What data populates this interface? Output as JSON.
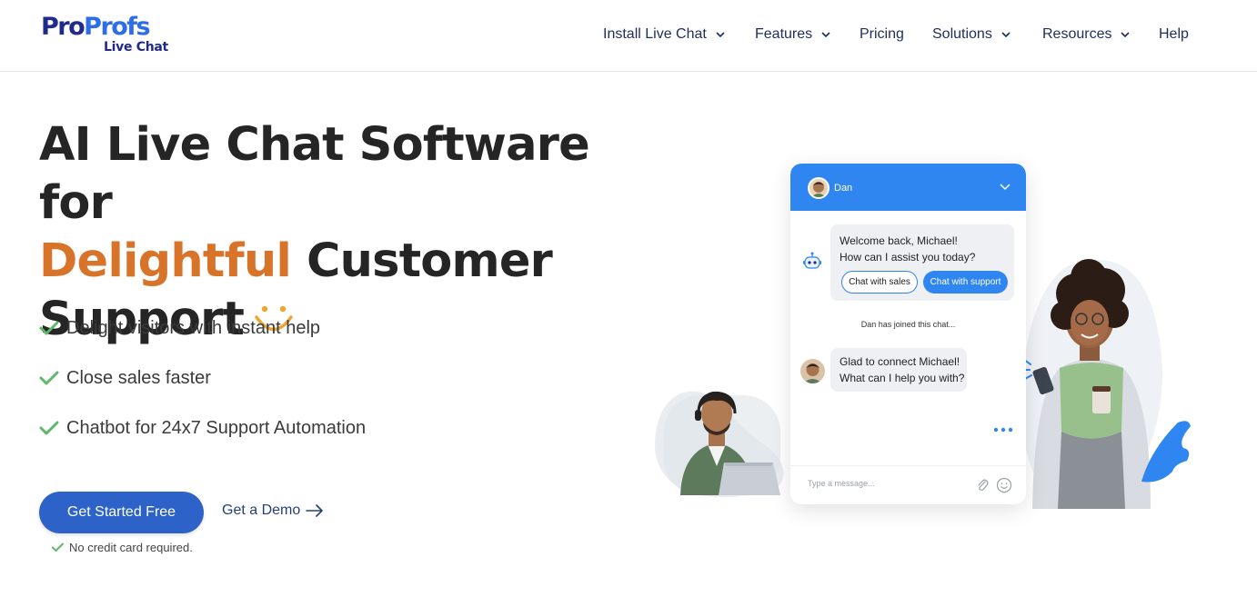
{
  "brand": {
    "logo_part1": "Pro",
    "logo_part2": "Profs",
    "logo_sub": "Live Chat",
    "colors": {
      "navy": "#1f2a8a",
      "blue": "#2d6ee8",
      "accent": "#d8742a",
      "cta": "#2d63c8",
      "check": "#5fb86a"
    }
  },
  "nav": {
    "items": [
      {
        "label": "Install Live Chat",
        "has_dropdown": true
      },
      {
        "label": "Features",
        "has_dropdown": true
      },
      {
        "label": "Pricing",
        "has_dropdown": false
      },
      {
        "label": "Solutions",
        "has_dropdown": true
      },
      {
        "label": "Resources",
        "has_dropdown": true
      },
      {
        "label": "Help",
        "has_dropdown": false
      }
    ]
  },
  "hero": {
    "title_line1": "AI Live Chat Software for",
    "title_accent": "Delightful",
    "title_line2_rest": " Customer",
    "title_line3": "Support",
    "bullets": [
      "Delight visitors with instant help",
      "Close sales faster",
      "Chatbot for 24x7 Support Automation"
    ],
    "cta_label": "Get Started Free",
    "demo_label": "Get a Demo",
    "note": "No credit card required."
  },
  "chat": {
    "agent_name": "Dan",
    "bot_line1": "Welcome back, Michael!",
    "bot_line2": "How can I assist you today?",
    "chip_sales": "Chat with sales",
    "chip_support": "Chat with support",
    "joined_notice": "Dan has joined this chat...",
    "agent_line1": "Glad to connect Michael!",
    "agent_line2": "What can I help you with?",
    "input_placeholder": "Type a message..."
  }
}
